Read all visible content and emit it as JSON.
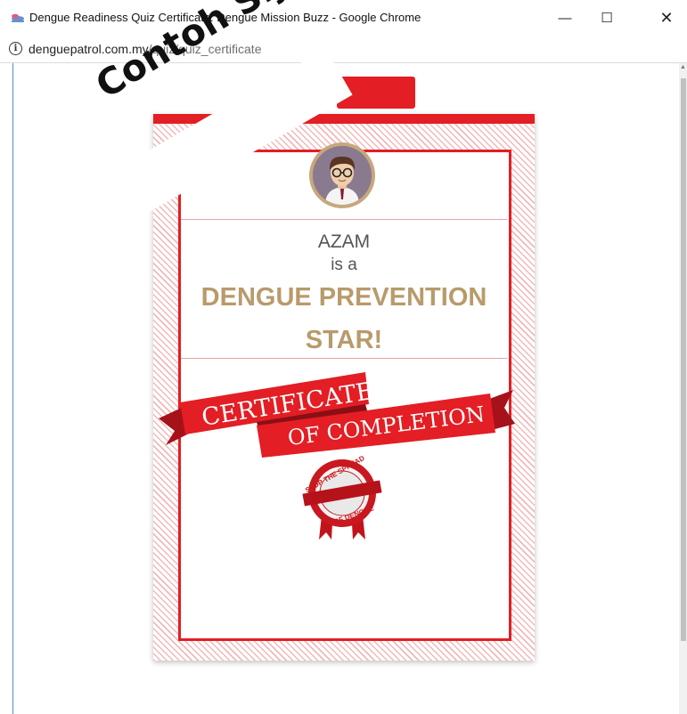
{
  "window": {
    "title": "Dengue Readiness Quiz Certificate: Dengue Mission Buzz - Google Chrome",
    "minimize_glyph": "—",
    "maximize_glyph": "☐",
    "close_glyph": "✕"
  },
  "address": {
    "domain": "denguepatrol.com.my",
    "path": "/quiz/quiz_certificate"
  },
  "certificate": {
    "name": "AZAM",
    "is_a": "is a",
    "title_line1": "DENGUE PREVENTION",
    "title_line2": "STAR!",
    "ribbon_line1": "CERTIFICATE",
    "ribbon_line2": "OF COMPLETION",
    "seal_top": "STOP THE SPREAD",
    "seal_bottom": "OF DENGUE"
  },
  "overlay": {
    "sample_label": "Contoh Sijil"
  },
  "colors": {
    "accent_red": "#e31e24",
    "gold": "#b99a6b"
  }
}
